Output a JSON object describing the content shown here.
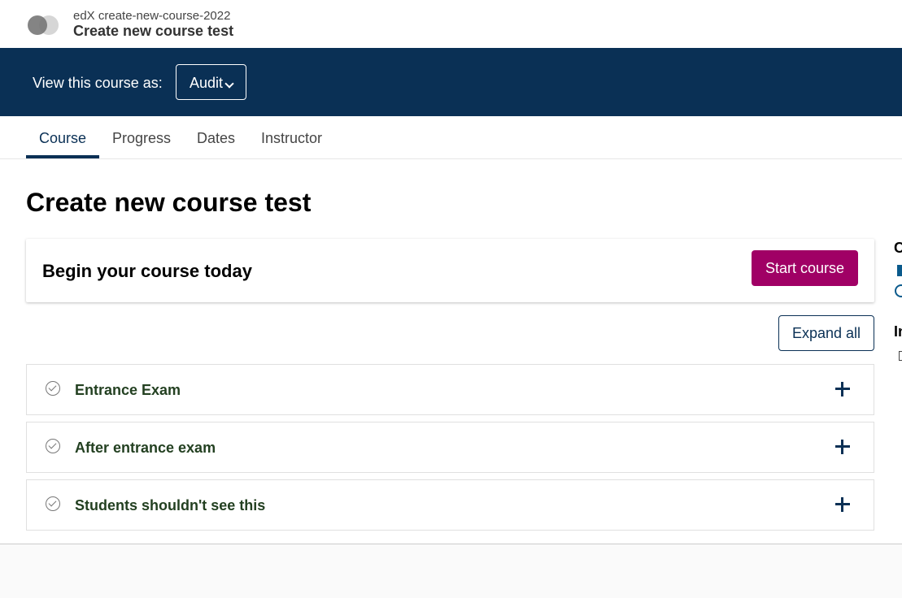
{
  "header": {
    "org": "edX create-new-course-2022",
    "course_title": "Create new course test"
  },
  "masquerade": {
    "label": "View this course as:",
    "selected": "Audit"
  },
  "tabs": [
    {
      "label": "Course",
      "active": true
    },
    {
      "label": "Progress",
      "active": false
    },
    {
      "label": "Dates",
      "active": false
    },
    {
      "label": "Instructor",
      "active": false
    }
  ],
  "main": {
    "page_title": "Create new course test",
    "begin_text": "Begin your course today",
    "start_label": "Start course",
    "expand_label": "Expand all",
    "sections": [
      {
        "title": "Entrance Exam"
      },
      {
        "title": "After entrance exam"
      },
      {
        "title": "Students shouldn't see this"
      }
    ]
  },
  "sidebar": {
    "heading1_partial": "C",
    "heading2_partial": "In"
  },
  "colors": {
    "brand_dark": "#0a3055",
    "start_button": "#a00065",
    "section_title": "#234021"
  },
  "icons": {
    "section_status": "check-circle-icon",
    "section_toggle": "plus-icon",
    "masquerade_dropdown": "chevron-down-icon"
  }
}
